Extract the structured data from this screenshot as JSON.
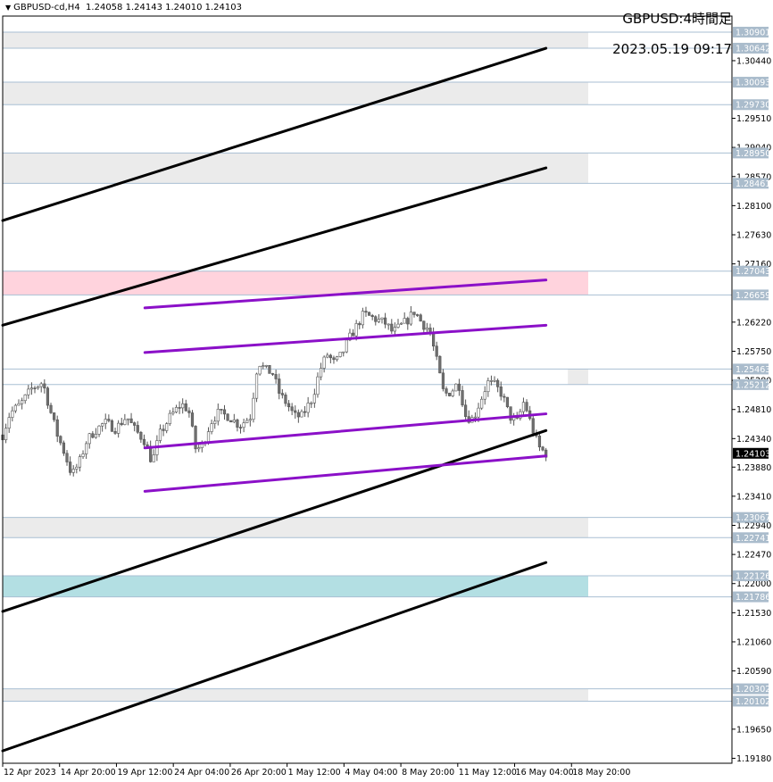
{
  "header": {
    "symbol_info": "GBPUSD-cd,H4",
    "ohlc": "1.24058 1.24143 1.24010 1.24103"
  },
  "overlay": {
    "title": "GBPUSD:4時間足",
    "datetime": "2023.05.19 09:17"
  },
  "chart_data": {
    "type": "candlestick",
    "symbol": "GBPUSD",
    "timeframe": "H4",
    "current_price": "1.24103",
    "ylim": [
      1.191,
      1.3116
    ],
    "y_ticks": [
      "1.30440",
      "1.29510",
      "1.29040",
      "1.28570",
      "1.28100",
      "1.27630",
      "1.27160",
      "1.26220",
      "1.25750",
      "1.25280",
      "1.24810",
      "1.24340",
      "1.23880",
      "1.23410",
      "1.22940",
      "1.22470",
      "1.22000",
      "1.21530",
      "1.21060",
      "1.20590",
      "1.19650",
      "1.19180"
    ],
    "x_ticks": [
      "12 Apr 2023",
      "14 Apr 20:00",
      "19 Apr 12:00",
      "24 Apr 04:00",
      "26 Apr 20:00",
      "1 May 12:00",
      "4 May 04:00",
      "8 May 20:00",
      "11 May 12:00",
      "16 May 04:00",
      "18 May 20:00"
    ],
    "level_labels": [
      "1.30901",
      "1.30642",
      "1.30093",
      "1.29730",
      "1.28950",
      "1.28461",
      "1.27043",
      "1.26659",
      "1.25463",
      "1.25212",
      "1.23067",
      "1.22741",
      "1.22126",
      "1.21786",
      "1.20302",
      "1.20102"
    ],
    "zones": [
      {
        "top": 1.30901,
        "bottom": 1.30642,
        "color": "#ebebeb"
      },
      {
        "top": 1.30093,
        "bottom": 1.2973,
        "color": "#ebebeb"
      },
      {
        "top": 1.2895,
        "bottom": 1.28461,
        "color": "#ebebeb"
      },
      {
        "top": 1.27043,
        "bottom": 1.26659,
        "color": "#ffd3dd"
      },
      {
        "top": 1.25463,
        "bottom": 1.25212,
        "color": "#ebebeb",
        "partial": true
      },
      {
        "top": 1.23067,
        "bottom": 1.22741,
        "color": "#ebebeb"
      },
      {
        "top": 1.22126,
        "bottom": 1.21786,
        "color": "#b3dfe3"
      },
      {
        "top": 1.20302,
        "bottom": 1.20102,
        "color": "#ebebeb"
      }
    ],
    "trend_lines": [
      {
        "color": "#000000",
        "x0": 0.0,
        "y0": 1.2786,
        "x1": 0.745,
        "y1": 1.3064
      },
      {
        "color": "#000000",
        "x0": 0.0,
        "y0": 1.2617,
        "x1": 0.745,
        "y1": 1.2871
      },
      {
        "color": "#000000",
        "x0": 0.0,
        "y0": 1.2155,
        "x1": 0.745,
        "y1": 1.2447
      },
      {
        "color": "#000000",
        "x0": 0.0,
        "y0": 1.193,
        "x1": 0.745,
        "y1": 1.2234
      },
      {
        "color": "#8b10c8",
        "x0": 0.195,
        "y0": 1.2645,
        "x1": 0.745,
        "y1": 1.269
      },
      {
        "color": "#8b10c8",
        "x0": 0.195,
        "y0": 1.2573,
        "x1": 0.745,
        "y1": 1.2617
      },
      {
        "color": "#8b10c8",
        "x0": 0.195,
        "y0": 1.2419,
        "x1": 0.745,
        "y1": 1.2474
      },
      {
        "color": "#8b10c8",
        "x0": 0.195,
        "y0": 1.2349,
        "x1": 0.745,
        "y1": 1.2406
      }
    ],
    "price_path": [
      [
        0.0,
        1.244
      ],
      [
        0.01,
        1.2475
      ],
      [
        0.025,
        1.249
      ],
      [
        0.04,
        1.2515
      ],
      [
        0.055,
        1.2525
      ],
      [
        0.065,
        1.248
      ],
      [
        0.075,
        1.244
      ],
      [
        0.085,
        1.241
      ],
      [
        0.095,
        1.2375
      ],
      [
        0.105,
        1.2395
      ],
      [
        0.115,
        1.243
      ],
      [
        0.125,
        1.2445
      ],
      [
        0.14,
        1.246
      ],
      [
        0.155,
        1.245
      ],
      [
        0.17,
        1.247
      ],
      [
        0.18,
        1.245
      ],
      [
        0.195,
        1.243
      ],
      [
        0.205,
        1.2395
      ],
      [
        0.215,
        1.244
      ],
      [
        0.23,
        1.247
      ],
      [
        0.245,
        1.249
      ],
      [
        0.255,
        1.248
      ],
      [
        0.265,
        1.2415
      ],
      [
        0.275,
        1.2425
      ],
      [
        0.285,
        1.246
      ],
      [
        0.295,
        1.2475
      ],
      [
        0.31,
        1.247
      ],
      [
        0.325,
        1.2455
      ],
      [
        0.34,
        1.247
      ],
      [
        0.35,
        1.256
      ],
      [
        0.36,
        1.2545
      ],
      [
        0.37,
        1.254
      ],
      [
        0.38,
        1.2505
      ],
      [
        0.39,
        1.249
      ],
      [
        0.4,
        1.247
      ],
      [
        0.41,
        1.247
      ],
      [
        0.425,
        1.25
      ],
      [
        0.435,
        1.2545
      ],
      [
        0.445,
        1.257
      ],
      [
        0.455,
        1.2555
      ],
      [
        0.465,
        1.257
      ],
      [
        0.475,
        1.2595
      ],
      [
        0.485,
        1.2615
      ],
      [
        0.495,
        1.2635
      ],
      [
        0.505,
        1.263
      ],
      [
        0.515,
        1.2625
      ],
      [
        0.525,
        1.262
      ],
      [
        0.535,
        1.2605
      ],
      [
        0.545,
        1.2615
      ],
      [
        0.555,
        1.2625
      ],
      [
        0.565,
        1.264
      ],
      [
        0.575,
        1.262
      ],
      [
        0.585,
        1.261
      ],
      [
        0.595,
        1.256
      ],
      [
        0.605,
        1.2505
      ],
      [
        0.615,
        1.251
      ],
      [
        0.625,
        1.2525
      ],
      [
        0.635,
        1.247
      ],
      [
        0.645,
        1.2465
      ],
      [
        0.655,
        1.2495
      ],
      [
        0.665,
        1.2525
      ],
      [
        0.675,
        1.252
      ],
      [
        0.685,
        1.2505
      ],
      [
        0.695,
        1.247
      ],
      [
        0.705,
        1.246
      ],
      [
        0.715,
        1.2495
      ],
      [
        0.725,
        1.2455
      ],
      [
        0.735,
        1.242
      ],
      [
        0.745,
        1.241
      ]
    ]
  }
}
